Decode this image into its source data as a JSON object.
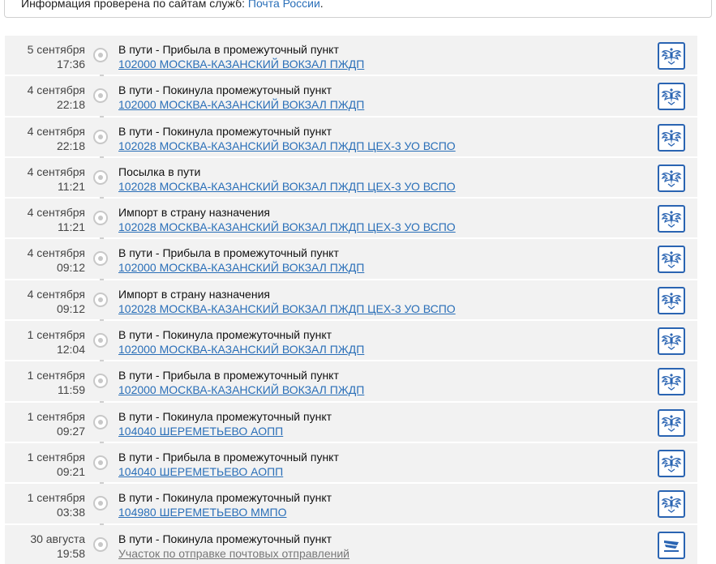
{
  "info": {
    "prefix": "Информация проверена по сайтам служб:",
    "service_link": "Почта России",
    "suffix": "."
  },
  "events": [
    {
      "date": "5 сентября",
      "time": "17:36",
      "status": "В пути - Прибыла в промежуточный пункт",
      "place": "102000 МОСКВА-КАЗАНСКИЙ ВОКЗАЛ ПЖДП",
      "place_is_link": true,
      "icon": "russian-post-eagle-icon"
    },
    {
      "date": "4 сентября",
      "time": "22:18",
      "status": "В пути - Покинула промежуточный пункт",
      "place": "102000 МОСКВА-КАЗАНСКИЙ ВОКЗАЛ ПЖДП",
      "place_is_link": true,
      "icon": "russian-post-eagle-icon"
    },
    {
      "date": "4 сентября",
      "time": "22:18",
      "status": "В пути - Покинула промежуточный пункт",
      "place": "102028 МОСКВА-КАЗАНСКИЙ ВОКЗАЛ ПЖДП ЦЕХ-3 УО ВСПО",
      "place_is_link": true,
      "icon": "russian-post-eagle-icon"
    },
    {
      "date": "4 сентября",
      "time": "11:21",
      "status": "Посылка в пути",
      "place": "102028 МОСКВА-КАЗАНСКИЙ ВОКЗАЛ ПЖДП ЦЕХ-3 УО ВСПО",
      "place_is_link": true,
      "icon": "russian-post-eagle-icon"
    },
    {
      "date": "4 сентября",
      "time": "11:21",
      "status": "Импорт в страну назначения",
      "place": "102028 МОСКВА-КАЗАНСКИЙ ВОКЗАЛ ПЖДП ЦЕХ-3 УО ВСПО",
      "place_is_link": true,
      "icon": "russian-post-eagle-icon"
    },
    {
      "date": "4 сентября",
      "time": "09:12",
      "status": "В пути - Прибыла в промежуточный пункт",
      "place": "102000 МОСКВА-КАЗАНСКИЙ ВОКЗАЛ ПЖДП",
      "place_is_link": true,
      "icon": "russian-post-eagle-icon"
    },
    {
      "date": "4 сентября",
      "time": "09:12",
      "status": "Импорт в страну назначения",
      "place": "102028 МОСКВА-КАЗАНСКИЙ ВОКЗАЛ ПЖДП ЦЕХ-3 УО ВСПО",
      "place_is_link": true,
      "icon": "russian-post-eagle-icon"
    },
    {
      "date": "1 сентября",
      "time": "12:04",
      "status": "В пути - Покинула промежуточный пункт",
      "place": "102000 МОСКВА-КАЗАНСКИЙ ВОКЗАЛ ПЖДП",
      "place_is_link": true,
      "icon": "russian-post-eagle-icon"
    },
    {
      "date": "1 сентября",
      "time": "11:59",
      "status": "В пути - Прибыла в промежуточный пункт",
      "place": "102000 МОСКВА-КАЗАНСКИЙ ВОКЗАЛ ПЖДП",
      "place_is_link": true,
      "icon": "russian-post-eagle-icon"
    },
    {
      "date": "1 сентября",
      "time": "09:27",
      "status": "В пути - Покинула промежуточный пункт",
      "place": "104040 ШЕРЕМЕТЬЕВО АОПП",
      "place_is_link": true,
      "icon": "russian-post-eagle-icon"
    },
    {
      "date": "1 сентября",
      "time": "09:21",
      "status": "В пути - Прибыла в промежуточный пункт",
      "place": "104040 ШЕРЕМЕТЬЕВО АОПП",
      "place_is_link": true,
      "icon": "russian-post-eagle-icon"
    },
    {
      "date": "1 сентября",
      "time": "03:38",
      "status": "В пути - Покинула промежуточный пункт",
      "place": "104980 ШЕРЕМЕТЬЕВО ММПО",
      "place_is_link": true,
      "icon": "russian-post-eagle-icon"
    },
    {
      "date": "30 августа",
      "time": "19:58",
      "status": "В пути - Покинула промежуточный пункт",
      "place": "Участок по отправке почтовых отправлений",
      "place_is_link": false,
      "icon": "kazpost-icon"
    }
  ],
  "colors": {
    "link": "#2a6fb8",
    "row_background": "#f2f2f2",
    "timeline": "#cfcfcf",
    "icon_border": "#2a64b2"
  }
}
